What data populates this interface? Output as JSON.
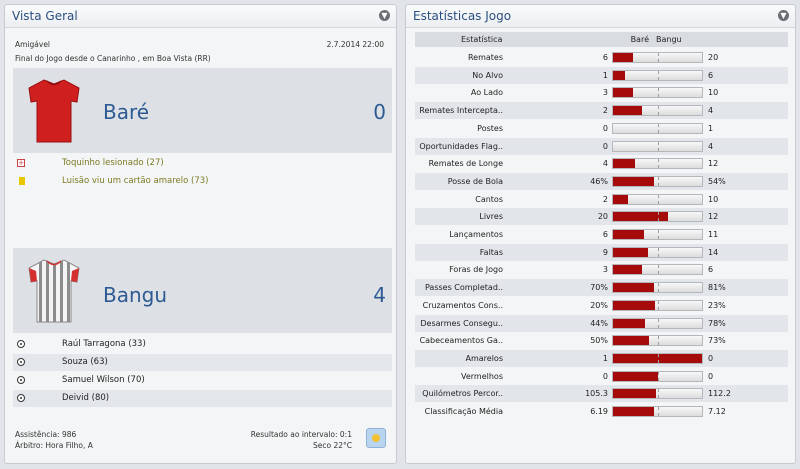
{
  "left_panel": {
    "title": "Vista Geral",
    "competition": "Amigável",
    "date": "2.7.2014 22:00",
    "status": "Final do Jogo desde o Canarinho , em Boa Vista (RR)",
    "home": {
      "name": "Baré",
      "score": "0"
    },
    "home_events": [
      {
        "type": "injury",
        "text": "Toquinho lesionado (27)"
      },
      {
        "type": "yellow-card",
        "text": "Luisão viu um cartão amarelo (73)"
      }
    ],
    "away": {
      "name": "Bangu",
      "score": "4"
    },
    "away_goals": [
      {
        "text": "Raúl Tarragona (33)"
      },
      {
        "text": "Souza (63)"
      },
      {
        "text": "Samuel Wilson (70)"
      },
      {
        "text": "Deivid (80)"
      }
    ],
    "attendance": "Assistência: 986",
    "referee": "Árbitro: Hora Filho, A",
    "halftime": "Resultado ao intervalo: 0:1",
    "weather": "Seco 22°C"
  },
  "right_panel": {
    "title": "Estatísticas Jogo",
    "header": {
      "stat": "Estatística",
      "home": "Baré",
      "away": "Bangu"
    },
    "stats": [
      {
        "label": "Remates",
        "home": "6",
        "away": "20",
        "share": 0.23
      },
      {
        "label": "No Alvo",
        "home": "1",
        "away": "6",
        "share": 0.14
      },
      {
        "label": "Ao Lado",
        "home": "3",
        "away": "10",
        "share": 0.23
      },
      {
        "label": "Remates Intercepta..",
        "home": "2",
        "away": "4",
        "share": 0.33
      },
      {
        "label": "Postes",
        "home": "0",
        "away": "1",
        "share": 0.0
      },
      {
        "label": "Oportunidades Flag..",
        "home": "0",
        "away": "4",
        "share": 0.0
      },
      {
        "label": "Remates de Longe",
        "home": "4",
        "away": "12",
        "share": 0.25
      },
      {
        "label": "Posse de Bola",
        "home": "46%",
        "away": "54%",
        "share": 0.46
      },
      {
        "label": "Cantos",
        "home": "2",
        "away": "10",
        "share": 0.17
      },
      {
        "label": "Livres",
        "home": "20",
        "away": "12",
        "share": 0.62
      },
      {
        "label": "Lançamentos",
        "home": "6",
        "away": "11",
        "share": 0.35
      },
      {
        "label": "Faltas",
        "home": "9",
        "away": "14",
        "share": 0.39
      },
      {
        "label": "Foras de Jogo",
        "home": "3",
        "away": "6",
        "share": 0.33
      },
      {
        "label": "Passes Completad..",
        "home": "70%",
        "away": "81%",
        "share": 0.46
      },
      {
        "label": "Cruzamentos Cons..",
        "home": "20%",
        "away": "23%",
        "share": 0.47
      },
      {
        "label": "Desarmes Consegu..",
        "home": "44%",
        "away": "78%",
        "share": 0.36
      },
      {
        "label": "Cabeceamentos Ga..",
        "home": "50%",
        "away": "73%",
        "share": 0.41
      },
      {
        "label": "Amarelos",
        "home": "1",
        "away": "0",
        "share": 1.0
      },
      {
        "label": "Vermelhos",
        "home": "0",
        "away": "0",
        "share": 0.5
      },
      {
        "label": "Quilómetros Percor..",
        "home": "105.3",
        "away": "112.2",
        "share": 0.48
      },
      {
        "label": "Classificação Média",
        "home": "6.19",
        "away": "7.12",
        "share": 0.46
      }
    ]
  },
  "colors": {
    "accent": "#2d5a92",
    "bar": "#a60b0b",
    "event_text": "#7c7a22"
  }
}
